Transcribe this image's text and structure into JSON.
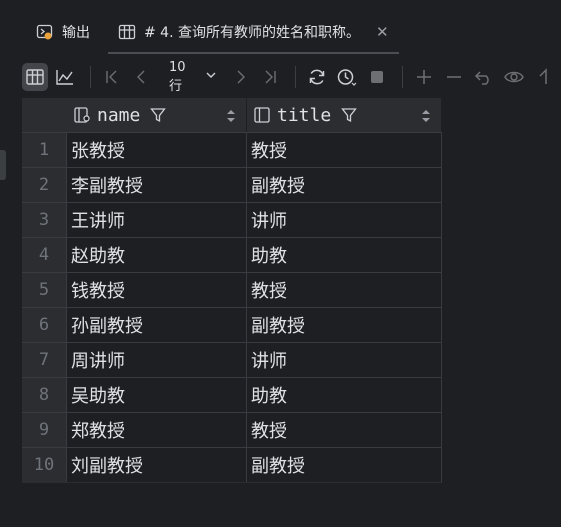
{
  "tabs": [
    {
      "label": "输出",
      "icon": "output-icon"
    },
    {
      "label": "# 4. 查询所有教师的姓名和职称。",
      "icon": "table-icon",
      "active": true
    }
  ],
  "toolbar": {
    "rows_label": "10 行"
  },
  "columns": [
    {
      "label": "name",
      "icon": "column-key-icon"
    },
    {
      "label": "title",
      "icon": "column-icon"
    }
  ],
  "rows": [
    {
      "n": "1",
      "name": "张教授",
      "title": "教授"
    },
    {
      "n": "2",
      "name": "李副教授",
      "title": "副教授"
    },
    {
      "n": "3",
      "name": "王讲师",
      "title": "讲师"
    },
    {
      "n": "4",
      "name": "赵助教",
      "title": "助教"
    },
    {
      "n": "5",
      "name": "钱教授",
      "title": "教授"
    },
    {
      "n": "6",
      "name": "孙副教授",
      "title": "副教授"
    },
    {
      "n": "7",
      "name": "周讲师",
      "title": "讲师"
    },
    {
      "n": "8",
      "name": "吴助教",
      "title": "助教"
    },
    {
      "n": "9",
      "name": "郑教授",
      "title": "教授"
    },
    {
      "n": "10",
      "name": "刘副教授",
      "title": "副教授"
    }
  ]
}
